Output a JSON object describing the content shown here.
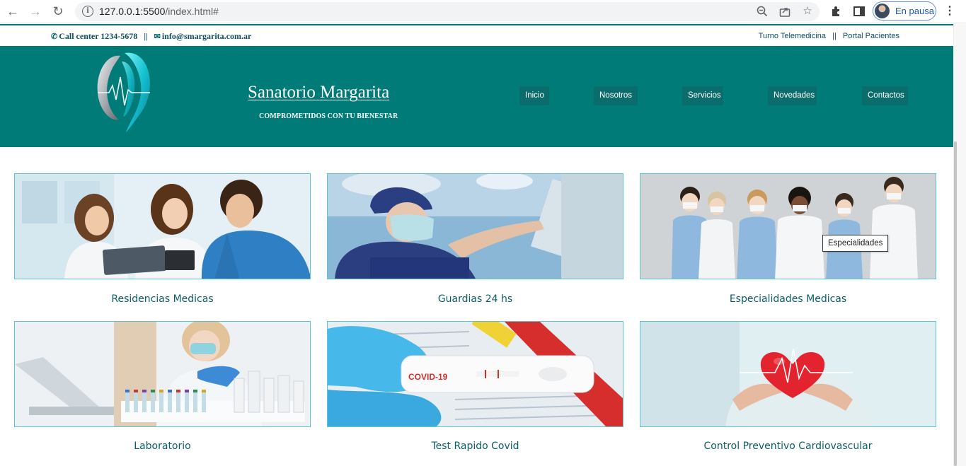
{
  "browser": {
    "url_host": "127.0.0.1:5500",
    "url_path": "/index.html#",
    "profile_label": "En pausa"
  },
  "topbar": {
    "phone": "Call center 1234-5678",
    "separator": "||",
    "email": "info@smargarita.com.ar",
    "link_telemedicina": "Turno Telemedicina",
    "link_separator": "||",
    "link_portal": "Portal Pacientes"
  },
  "header": {
    "brand": "Sanatorio Margarita",
    "tagline": "COMPROMETIDOS CON TU BIENESTAR",
    "menu": [
      "Inicio",
      "Nosotros",
      "Servicios",
      "Novedades",
      "Contactos"
    ]
  },
  "cards": [
    {
      "caption": "Residencias Medicas"
    },
    {
      "caption": "Guardias 24 hs"
    },
    {
      "caption": "Especialidades Medicas"
    },
    {
      "caption": "Laboratorio"
    },
    {
      "caption": "Test Rapido Covid"
    },
    {
      "caption": "Control Preventivo Cardiovascular"
    }
  ],
  "tooltip": "Especialidades",
  "covid_label": "COVID-19",
  "colors": {
    "header_bg": "#007b78",
    "menu_btn_bg": "#0a6d6c",
    "card_border": "#5dc6cf",
    "caption_text": "#0b5e66"
  }
}
